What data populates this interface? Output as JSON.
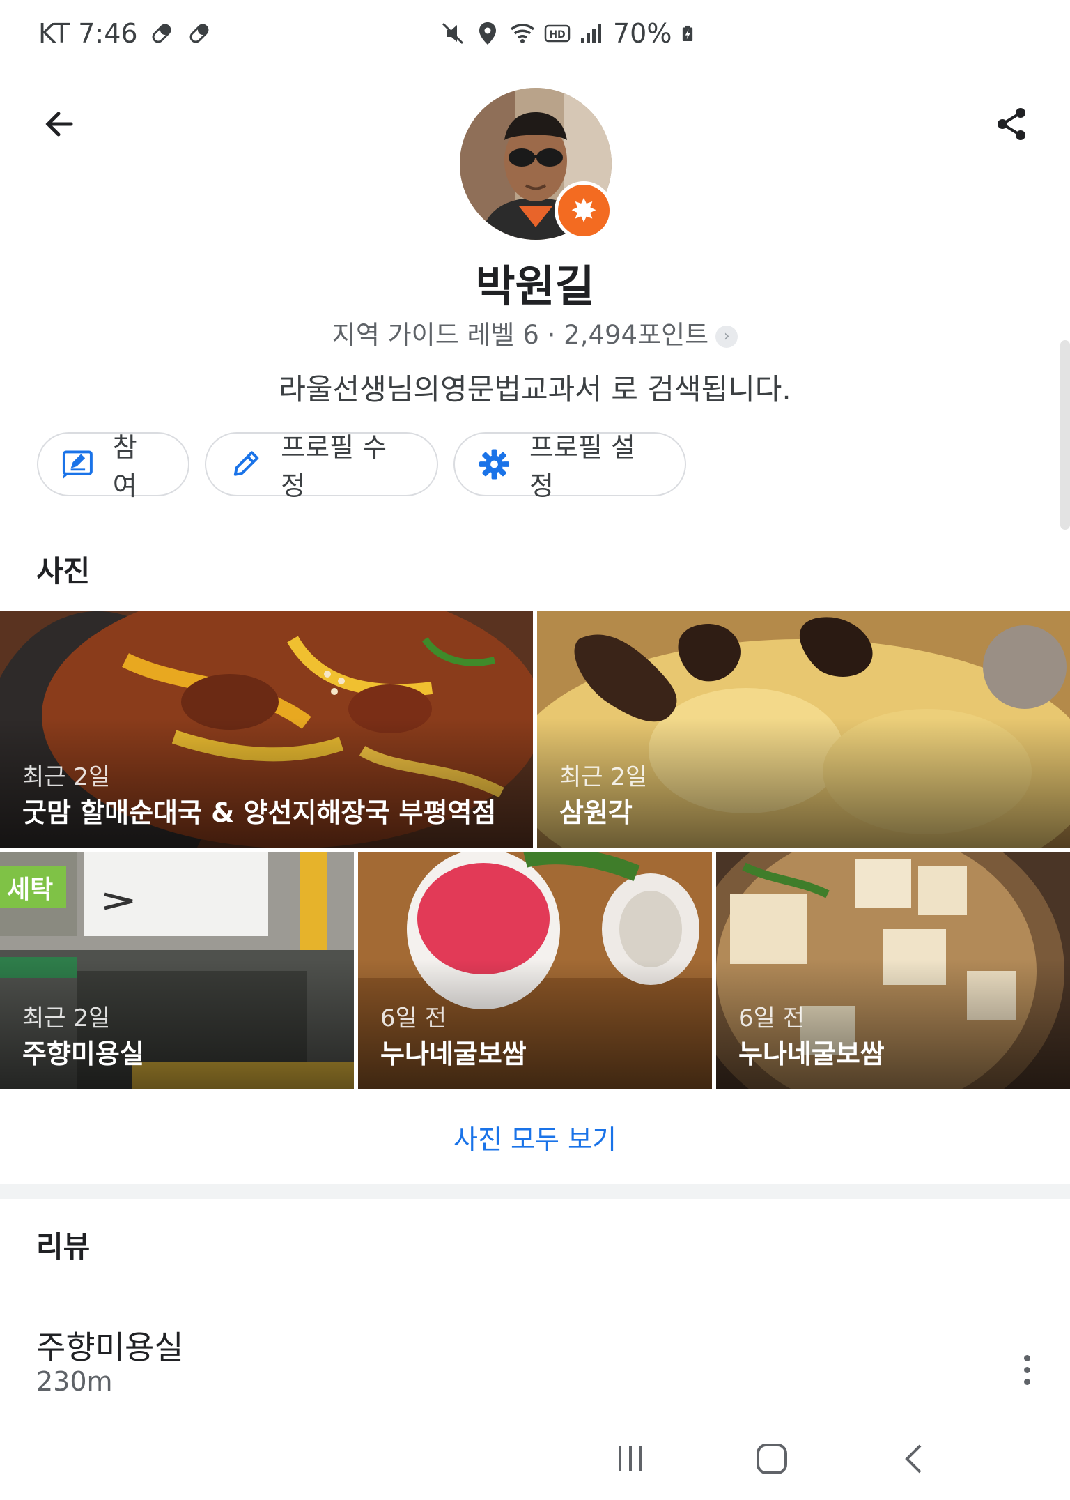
{
  "status_bar": {
    "carrier_time": "KT 7:46",
    "battery": "70%"
  },
  "profile": {
    "name": "박원길",
    "level_line": "지역 가이드 레벨 6 · 2,494포인트",
    "bio": "라울선생님의영문법교과서 로 검색됩니다."
  },
  "actions": [
    {
      "label": "참여",
      "icon": "contribute-icon"
    },
    {
      "label": "프로필 수정",
      "icon": "pencil-icon"
    },
    {
      "label": "프로필 설정",
      "icon": "gear-icon"
    }
  ],
  "photos": {
    "title": "사진",
    "items": [
      {
        "date": "최근 2일",
        "place": "굿맘 할매순대국 & 양선지해장국 부평역점"
      },
      {
        "date": "최근 2일",
        "place": "삼원각"
      },
      {
        "date": "최근 2일",
        "place": "주향미용실"
      },
      {
        "date": "6일 전",
        "place": "누나네굴보쌈"
      },
      {
        "date": "6일 전",
        "place": "누나네굴보쌈"
      }
    ],
    "see_all": "사진 모두 보기"
  },
  "reviews": {
    "title": "리뷰",
    "first": {
      "place": "주향미용실",
      "distance": "230m"
    }
  },
  "colors": {
    "accent": "#1a73e8",
    "badge": "#f36b21",
    "chip_border": "#dadce0"
  }
}
